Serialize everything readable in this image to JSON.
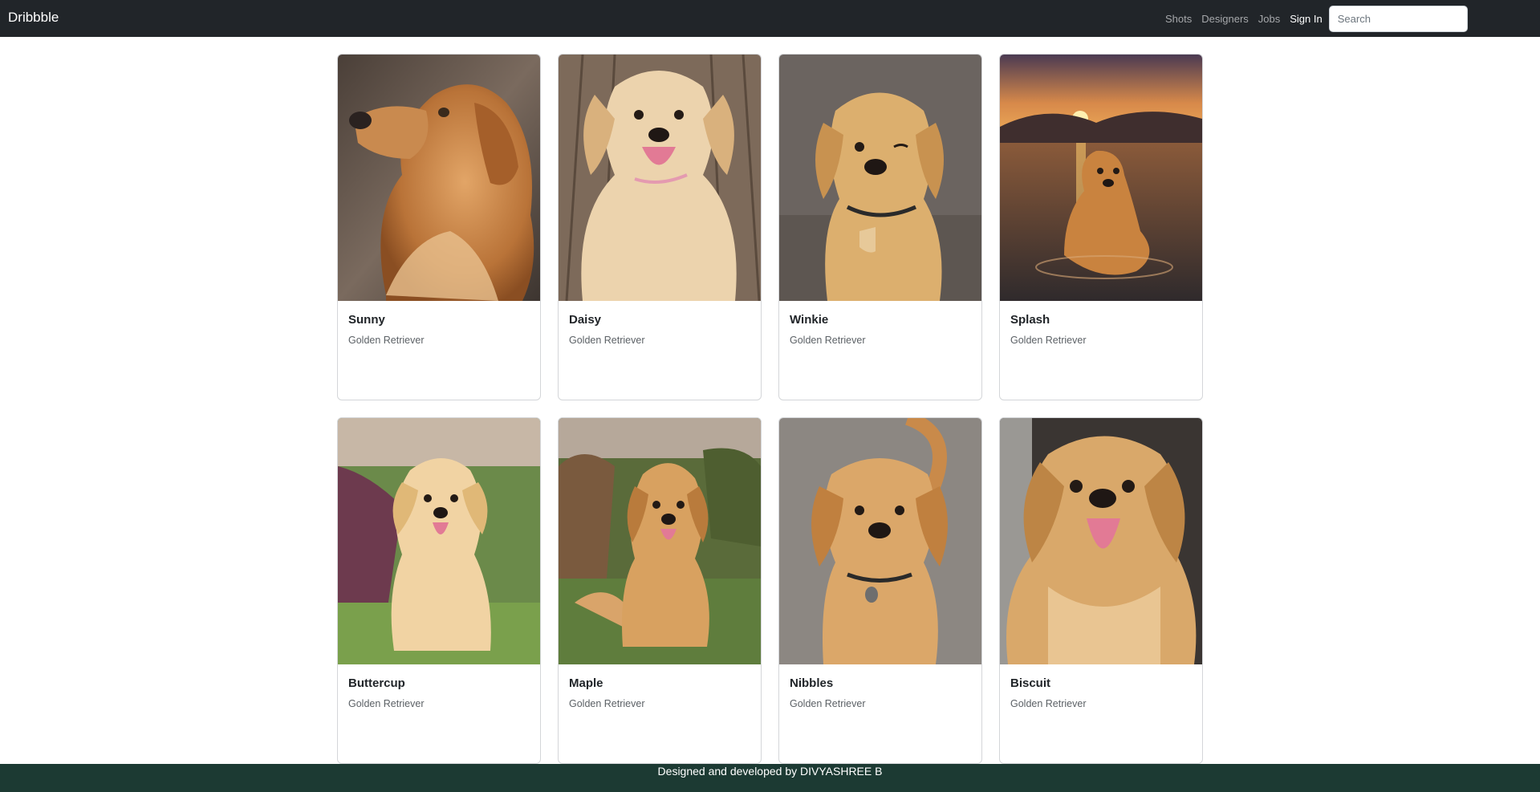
{
  "navbar": {
    "brand": "Dribbble",
    "links": [
      "Shots",
      "Designers",
      "Jobs"
    ],
    "signin": "Sign In",
    "search_placeholder": "Search"
  },
  "cards": [
    {
      "name": "Sunny",
      "breed": "Golden Retriever",
      "photo": "golden-retriever-profile-photo"
    },
    {
      "name": "Daisy",
      "breed": "Golden Retriever",
      "photo": "golden-puppy-on-deck-photo"
    },
    {
      "name": "Winkie",
      "breed": "Golden Retriever",
      "photo": "winking-golden-puppy-photo"
    },
    {
      "name": "Splash",
      "breed": "Golden Retriever",
      "photo": "golden-retriever-in-lake-sunset-photo"
    },
    {
      "name": "Buttercup",
      "breed": "Golden Retriever",
      "photo": "golden-puppy-in-garden-photo"
    },
    {
      "name": "Maple",
      "breed": "Golden Retriever",
      "photo": "golden-puppy-on-grass-photo"
    },
    {
      "name": "Nibbles",
      "breed": "Golden Retriever",
      "photo": "golden-puppy-on-pavement-photo"
    },
    {
      "name": "Biscuit",
      "breed": "Golden Retriever",
      "photo": "smiling-golden-puppy-photo"
    }
  ],
  "footer": {
    "text": "Designed and developed by DIVYASHREE B"
  },
  "colors": {
    "navbar_bg": "#212529",
    "footer_bg": "#1c3a33",
    "card_border": "#d4d6d9"
  }
}
